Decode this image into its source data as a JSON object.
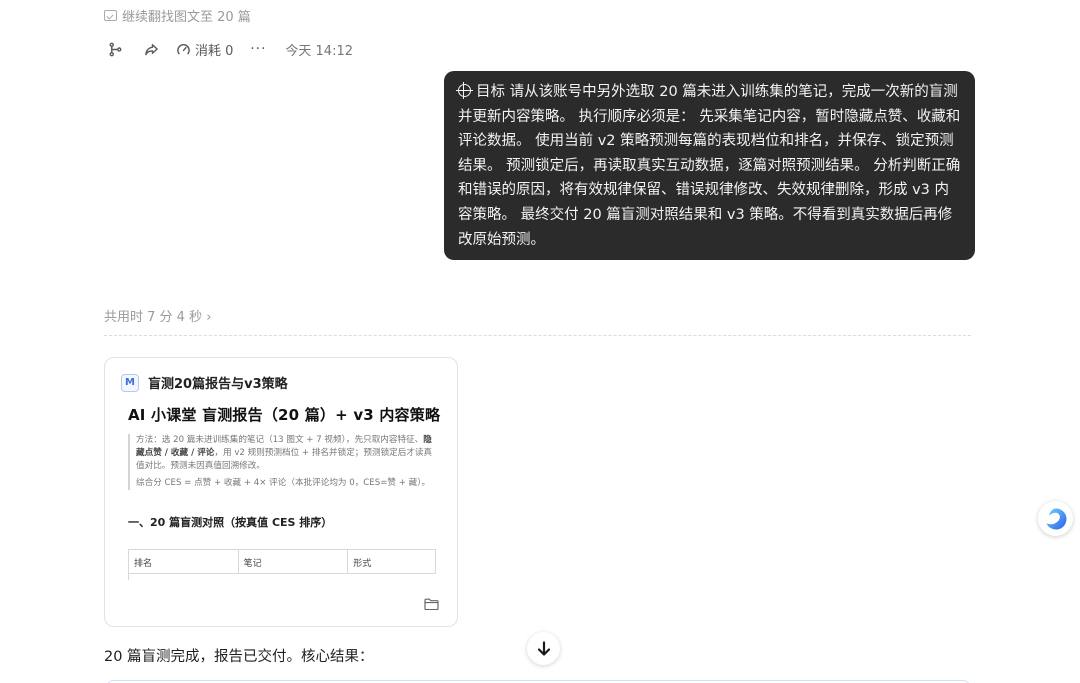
{
  "previous_turn": {
    "note": "继续翻找图文至 20 篇"
  },
  "actions": {
    "consume_label": "消耗 0",
    "more_label": "···",
    "timestamp": "今天 14:12"
  },
  "user_message": {
    "text": "目标 请从该账号中另外选取 20 篇未进入训练集的笔记，完成一次新的盲测并更新内容策略。 执行顺序必须是： 先采集笔记内容，暂时隐藏点赞、收藏和评论数据。 使用当前 v2 策略预测每篇的表现档位和排名，并保存、锁定预测结果。 预测锁定后，再读取真实互动数据，逐篇对照预测结果。 分析判断正确和错误的原因，将有效规律保留、错误规律修改、失效规律删除，形成 v3 内容策略。 最终交付 20 篇盲测对照结果和 v3 策略。不得看到真实数据后再修改原始预测。"
  },
  "elapsed": {
    "label": "共用时 7 分 4 秒",
    "chevron": "›"
  },
  "doc_card": {
    "logo_letter": "M",
    "name": "盲测20篇报告与v3策略",
    "preview_title": "AI 小课堂 盲测报告（20 篇）+ v3 内容策略",
    "method_prefix": "方法：选 20 篇未进训练集的笔记（13 图文 + 7 视频），先只取内容特征、",
    "method_bold": "隐藏点赞 / 收藏 / 评论",
    "method_suffix": "，用 v2 规则预测档位 + 排名并锁定；预测锁定后才读真值对比。预测未因真值回溯修改。",
    "ces_note": "综合分 CES = 点赞 + 收藏 + 4× 评论（本批评论均为 0，CES=赞 + 藏）。",
    "section_title": "一、20 篇盲测对照（按真值 CES 排序）",
    "table_headers": [
      "排名",
      "笔记",
      "形式"
    ]
  },
  "summary": {
    "text": "20 篇盲测完成，报告已交付。核心结果："
  },
  "colors": {
    "bubble_bg": "#2b2b2b",
    "accent": "#3b6fe0"
  }
}
